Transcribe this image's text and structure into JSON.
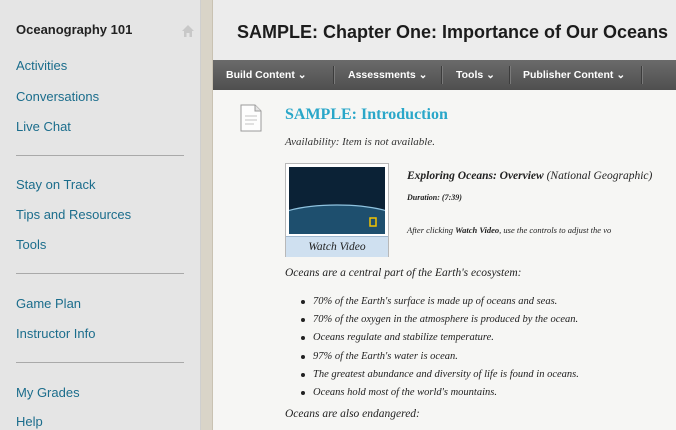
{
  "sidebar": {
    "course_title": "Oceanography 101",
    "groups": [
      [
        "Activities",
        "Conversations",
        "Live Chat"
      ],
      [
        "Stay on Track",
        "Tips and Resources",
        "Tools"
      ],
      [
        "Game Plan",
        "Instructor Info"
      ],
      [
        "My Grades",
        "Help"
      ]
    ]
  },
  "page": {
    "title": "SAMPLE: Chapter One: Importance of Our Oceans"
  },
  "toolbar": {
    "items": [
      "Build Content",
      "Assessments",
      "Tools",
      "Publisher Content"
    ],
    "chevron": "⌄"
  },
  "content": {
    "item_title": "SAMPLE: Introduction",
    "availability": "Availability:  Item is not available.",
    "video": {
      "button_label": "Watch Video",
      "title": "Exploring Oceans: Overview",
      "source": "(National Geographic)",
      "duration": "Duration: (7:39)",
      "instructions_prefix": "After clicking ",
      "instructions_bold": "Watch Video",
      "instructions_suffix": ", use the controls to adjust the vo"
    },
    "intro_paragraph": "Oceans are a central part of the Earth's ecosystem:",
    "bullets": [
      "70% of the Earth's surface is made up of oceans and seas.",
      "70% of the oxygen in the atmosphere is produced by the ocean.",
      "Oceans regulate and stabilize temperature.",
      "97% of the Earth's water is ocean.",
      "The greatest abundance and diversity of life is found in oceans.",
      "Oceans hold most of the world's mountains."
    ],
    "endangered_paragraph": "Oceans are also endangered:"
  },
  "colors": {
    "nav_link": "#1b6d8c",
    "item_title": "#2aa7c9",
    "toolbar_bg": "#585858",
    "sidebar_bg": "#e5e5e5"
  },
  "icons": {
    "home": "home-icon",
    "document": "document-icon"
  }
}
